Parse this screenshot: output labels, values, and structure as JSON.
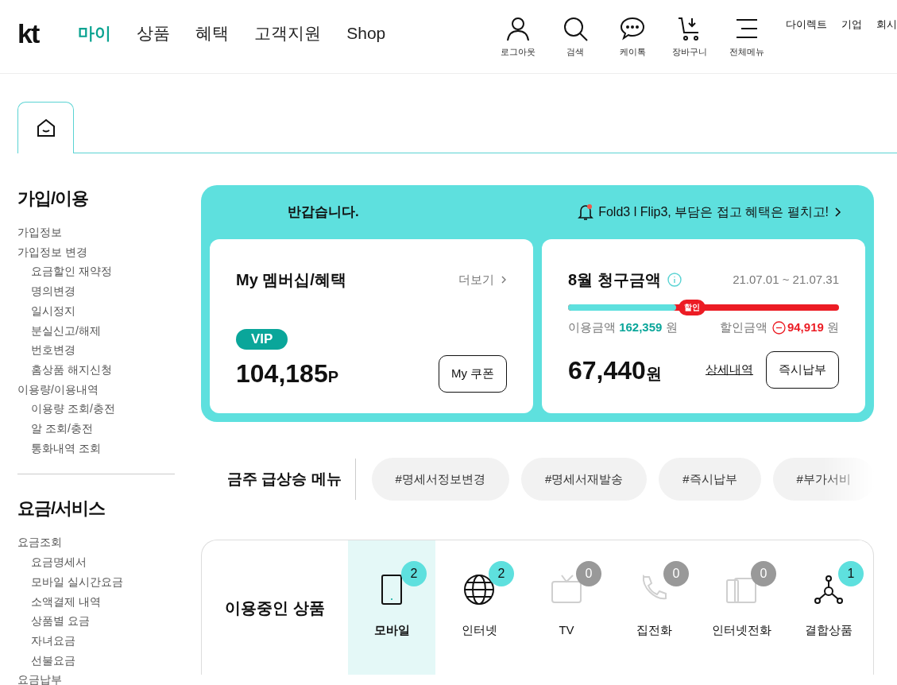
{
  "header": {
    "logo": "kt",
    "nav": [
      {
        "label": "마이",
        "selected": true
      },
      {
        "label": "상품",
        "selected": false
      },
      {
        "label": "혜택",
        "selected": false
      },
      {
        "label": "고객지원",
        "selected": false
      },
      {
        "label": "Shop",
        "selected": false
      }
    ],
    "utilities": [
      {
        "kind": "user",
        "label": "로그아웃"
      },
      {
        "kind": "search",
        "label": "검색"
      },
      {
        "kind": "chat",
        "label": "케이톡"
      },
      {
        "kind": "cart",
        "label": "장바구니"
      },
      {
        "kind": "menu",
        "label": "전체메뉴"
      }
    ],
    "links": [
      "다이렉트",
      "기업",
      "회시"
    ]
  },
  "sidebar": [
    {
      "title": "가입/이용",
      "items": [
        {
          "label": "가입정보"
        },
        {
          "label": "가입정보 변경",
          "children": [
            {
              "label": "요금할인 재약정"
            },
            {
              "label": "명의변경"
            },
            {
              "label": "일시정지"
            },
            {
              "label": "분실신고/해제"
            },
            {
              "label": "번호변경"
            },
            {
              "label": "홈상품 해지신청"
            }
          ]
        },
        {
          "label": "이용량/이용내역",
          "children": [
            {
              "label": "이용량 조회/충전"
            },
            {
              "label": "알 조회/충전"
            },
            {
              "label": "통화내역 조회"
            }
          ]
        }
      ]
    },
    {
      "title": "요금/서비스",
      "items": [
        {
          "label": "요금조회",
          "children": [
            {
              "label": "요금명세서"
            },
            {
              "label": "모바일 실시간요금"
            },
            {
              "label": "소액결제 내역"
            },
            {
              "label": "상품별 요금"
            },
            {
              "label": "자녀요금"
            },
            {
              "label": "선불요금"
            }
          ]
        },
        {
          "label": "요금납부"
        }
      ]
    }
  ],
  "summary": {
    "greeting": "반갑습니다.",
    "notice": "Fold3 l Flip3, 부담은 접고 혜택은 펼치고!",
    "membership": {
      "title": "My 멤버십/혜택",
      "more": "더보기",
      "grade": "VIP",
      "points": "104,185",
      "unit": "P",
      "button": "My 쿠폰"
    },
    "bill": {
      "title": "8월 청구금액",
      "period": "21.07.01 ~ 21.07.31",
      "level": 0.4,
      "discount_tag": "할인",
      "usage_label": "이용금액",
      "usage_amount": "162,359",
      "usage_unit": "원",
      "discount_label": "할인금액",
      "discount_amount": "94,919",
      "discount_unit": "원",
      "total": "67,440",
      "total_unit": "원",
      "detail_link": "상세내역",
      "pay_button": "즉시납부"
    }
  },
  "trending": {
    "title": "금주 급상승 메뉴",
    "tags": [
      "#명세서정보변경",
      "#명세서재발송",
      "#즉시납부",
      "#부가서비"
    ]
  },
  "products": {
    "title": "이용중인 상품",
    "items": [
      {
        "kind": "mobile",
        "label": "모바일",
        "count": "2",
        "active": true,
        "selected": true
      },
      {
        "kind": "internet",
        "label": "인터넷",
        "count": "2",
        "active": true,
        "selected": false
      },
      {
        "kind": "tv",
        "label": "TV",
        "count": "0",
        "active": false,
        "selected": false
      },
      {
        "kind": "phone",
        "label": "집전화",
        "count": "0",
        "active": false,
        "selected": false
      },
      {
        "kind": "voip",
        "label": "인터넷전화",
        "count": "0",
        "active": false,
        "selected": false
      },
      {
        "kind": "bundle",
        "label": "결합상품",
        "count": "1",
        "active": true,
        "selected": false
      }
    ]
  }
}
